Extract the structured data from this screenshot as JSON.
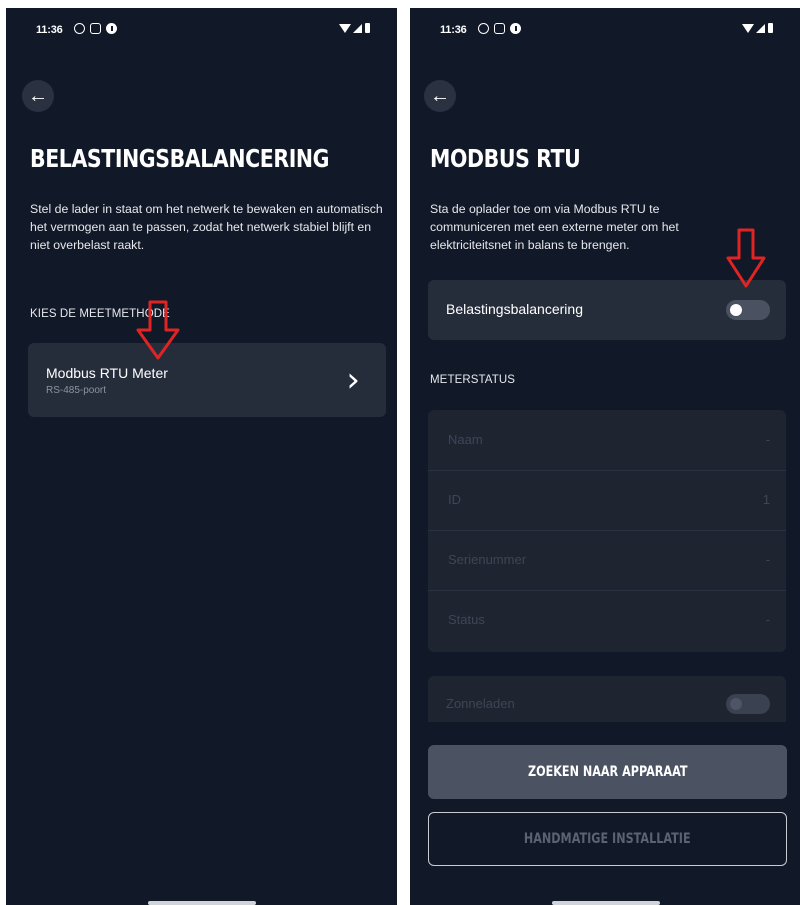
{
  "left": {
    "status_time": "11:36",
    "title": "BELASTINGSBALANCERING",
    "description": "Stel de lader in staat om het netwerk te bewaken en automatisch het vermogen aan te passen, zodat het netwerk stabiel blijft en niet overbelast raakt.",
    "section_label": "KIES DE MEETMETHODE",
    "method_card": {
      "title": "Modbus RTU Meter",
      "subtitle": "RS-485-poort",
      "icon": "chevron-right-icon"
    }
  },
  "right": {
    "status_time": "11:36",
    "title": "MODBUS RTU",
    "description": "Sta de oplader toe om via Modbus RTU te communiceren met een externe meter om het elektriciteitsnet in balans te brengen.",
    "load_balancing": {
      "label": "Belastingsbalancering",
      "enabled": false
    },
    "meter_status_label": "METERSTATUS",
    "meter_status": [
      {
        "label": "Naam",
        "value": "-"
      },
      {
        "label": "ID",
        "value": "1"
      },
      {
        "label": "Serienummer",
        "value": "-"
      },
      {
        "label": "Status",
        "value": "-"
      }
    ],
    "solar_charging": {
      "label": "Zonneladen",
      "enabled": false
    },
    "search_button": "ZOEKEN NAAR APPARAAT",
    "manual_button": "HANDMATIGE INSTALLATIE"
  },
  "colors": {
    "background": "#111827",
    "card": "#262d3a",
    "annotation_arrow": "#e02424"
  }
}
